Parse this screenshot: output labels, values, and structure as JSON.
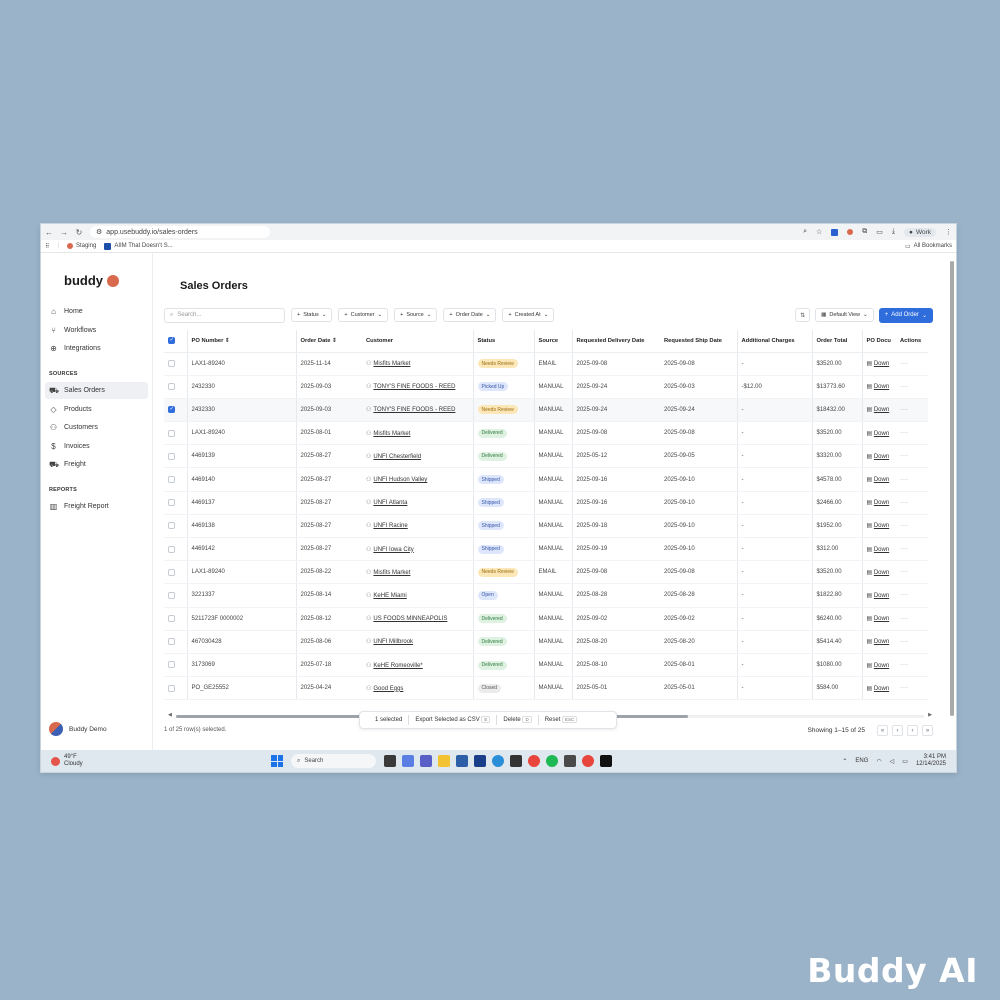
{
  "browser": {
    "url": "app.usebuddy.io/sales-orders",
    "profile": "Work",
    "bookmarks": [
      {
        "label": "Staging"
      },
      {
        "label": "AIIM That Doesn't S..."
      }
    ],
    "all_bookmarks": "All Bookmarks"
  },
  "sidebar": {
    "logo": "buddy",
    "items": [
      {
        "label": "Home",
        "icon": "home-icon"
      },
      {
        "label": "Workflows",
        "icon": "workflow-icon"
      },
      {
        "label": "Integrations",
        "icon": "globe-icon"
      }
    ],
    "sources_label": "SOURCES",
    "sources": [
      {
        "label": "Sales Orders",
        "icon": "cart-icon",
        "active": true
      },
      {
        "label": "Products",
        "icon": "tag-icon"
      },
      {
        "label": "Customers",
        "icon": "users-icon"
      },
      {
        "label": "Invoices",
        "icon": "dollar-icon"
      },
      {
        "label": "Freight",
        "icon": "truck-icon"
      }
    ],
    "reports_label": "REPORTS",
    "reports": [
      {
        "label": "Freight Report",
        "icon": "report-icon"
      }
    ],
    "user": "Buddy Demo"
  },
  "page": {
    "title": "Sales Orders",
    "search_placeholder": "Search...",
    "filters": [
      "Status",
      "Customer",
      "Source",
      "Order Date",
      "Created At"
    ],
    "view": "Default View",
    "add_order": "Add Order"
  },
  "table": {
    "columns": [
      "PO Number",
      "Order Date",
      "Customer",
      "Status",
      "Source",
      "Requested Delivery Date",
      "Requested Ship Date",
      "Additional Charges",
      "Order Total",
      "PO Docu",
      "Actions"
    ],
    "doc_label": "Down",
    "rows": [
      {
        "po": "LAX1-89240",
        "date": "2025-11-14",
        "customer": "Misfits Market",
        "status": "Needs Review",
        "status_kind": "review",
        "source": "EMAIL",
        "delivery": "2025-09-08",
        "ship": "2025-09-08",
        "charges": "-",
        "total": "$3520.00",
        "selected": false
      },
      {
        "po": "2432330",
        "date": "2025-09-03",
        "customer": "TONY'S FINE FOODS - REED",
        "status": "Picked Up",
        "status_kind": "picked",
        "source": "MANUAL",
        "delivery": "2025-09-24",
        "ship": "2025-09-03",
        "charges": "-$12.00",
        "total": "$13773.60",
        "selected": false
      },
      {
        "po": "2432330",
        "date": "2025-09-03",
        "customer": "TONY'S FINE FOODS - REED",
        "status": "Needs Review",
        "status_kind": "review",
        "source": "MANUAL",
        "delivery": "2025-09-24",
        "ship": "2025-09-24",
        "charges": "-",
        "total": "$18432.00",
        "selected": true
      },
      {
        "po": "LAX1-89240",
        "date": "2025-08-01",
        "customer": "Misfits Market",
        "status": "Delivered",
        "status_kind": "deliv",
        "source": "MANUAL",
        "delivery": "2025-09-08",
        "ship": "2025-09-08",
        "charges": "-",
        "total": "$3520.00",
        "selected": false
      },
      {
        "po": "4469139",
        "date": "2025-08-27",
        "customer": "UNFI Chesterfield",
        "status": "Delivered",
        "status_kind": "deliv",
        "source": "MANUAL",
        "delivery": "2025-05-12",
        "ship": "2025-09-05",
        "charges": "-",
        "total": "$3320.00",
        "selected": false
      },
      {
        "po": "4469140",
        "date": "2025-08-27",
        "customer": "UNFI Hudson Valley",
        "status": "Shipped",
        "status_kind": "ship",
        "source": "MANUAL",
        "delivery": "2025-09-16",
        "ship": "2025-09-10",
        "charges": "-",
        "total": "$4578.00",
        "selected": false
      },
      {
        "po": "4469137",
        "date": "2025-08-27",
        "customer": "UNFI Atlanta",
        "status": "Shipped",
        "status_kind": "ship",
        "source": "MANUAL",
        "delivery": "2025-09-16",
        "ship": "2025-09-10",
        "charges": "-",
        "total": "$2466.00",
        "selected": false
      },
      {
        "po": "4469138",
        "date": "2025-08-27",
        "customer": "UNFI Racine",
        "status": "Shipped",
        "status_kind": "ship",
        "source": "MANUAL",
        "delivery": "2025-09-18",
        "ship": "2025-09-10",
        "charges": "-",
        "total": "$1952.00",
        "selected": false
      },
      {
        "po": "4469142",
        "date": "2025-08-27",
        "customer": "UNFI Iowa City",
        "status": "Shipped",
        "status_kind": "ship",
        "source": "MANUAL",
        "delivery": "2025-09-19",
        "ship": "2025-09-10",
        "charges": "-",
        "total": "$312.00",
        "selected": false
      },
      {
        "po": "LAX1-89240",
        "date": "2025-08-22",
        "customer": "Misfits Market",
        "status": "Needs Review",
        "status_kind": "review",
        "source": "EMAIL",
        "delivery": "2025-09-08",
        "ship": "2025-09-08",
        "charges": "-",
        "total": "$3520.00",
        "selected": false
      },
      {
        "po": "3221337",
        "date": "2025-08-14",
        "customer": "KeHE Miami",
        "status": "Open",
        "status_kind": "open",
        "source": "MANUAL",
        "delivery": "2025-08-28",
        "ship": "2025-08-28",
        "charges": "-",
        "total": "$1822.80",
        "selected": false
      },
      {
        "po": "5211723F 0000002",
        "date": "2025-08-12",
        "customer": "US FOODS MINNEAPOLIS",
        "status": "Delivered",
        "status_kind": "deliv",
        "source": "MANUAL",
        "delivery": "2025-09-02",
        "ship": "2025-09-02",
        "charges": "-",
        "total": "$6240.00",
        "selected": false
      },
      {
        "po": "467030428",
        "date": "2025-08-06",
        "customer": "UNFI Millbrook",
        "status": "Delivered",
        "status_kind": "deliv",
        "source": "MANUAL",
        "delivery": "2025-08-20",
        "ship": "2025-08-20",
        "charges": "-",
        "total": "$5414.40",
        "selected": false
      },
      {
        "po": "3173069",
        "date": "2025-07-18",
        "customer": "KeHE Romeoville*",
        "status": "Delivered",
        "status_kind": "deliv",
        "source": "MANUAL",
        "delivery": "2025-08-10",
        "ship": "2025-08-01",
        "charges": "-",
        "total": "$1080.00",
        "selected": false
      },
      {
        "po": "PO_GE25552",
        "date": "2025-04-24",
        "customer": "Good Eggs",
        "status": "Closed",
        "status_kind": "closed",
        "source": "MANUAL",
        "delivery": "2025-05-01",
        "ship": "2025-05-01",
        "charges": "-",
        "total": "$584.00",
        "selected": false
      }
    ]
  },
  "selection_bar": {
    "count": "1 selected",
    "export": "Export Selected as CSV",
    "export_key": "E",
    "delete": "Delete",
    "delete_key": "D",
    "reset": "Reset",
    "reset_key": "ESC"
  },
  "footer": {
    "rows_selected": "1 of 25 row(s) selected.",
    "showing": "Showing 1–15 of 25"
  },
  "taskbar": {
    "temp": "49°F",
    "weather": "Cloudy",
    "search": "Search",
    "lang": "ENG",
    "time": "3:41 PM",
    "date": "12/14/2025"
  },
  "watermark": "Buddy AI"
}
